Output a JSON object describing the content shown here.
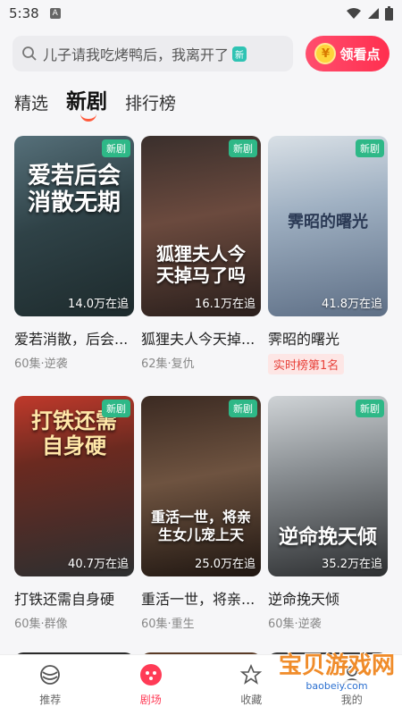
{
  "status": {
    "time": "5:38",
    "sim_icon": "A"
  },
  "search": {
    "query": "儿子请我吃烤鸭后，我离开了",
    "badge": "新"
  },
  "coin_button": {
    "label": "领看点",
    "coin_symbol": "¥"
  },
  "tabs": [
    {
      "label": "精选",
      "active": false
    },
    {
      "label": "新剧",
      "active": true
    },
    {
      "label": "排行榜",
      "active": false
    }
  ],
  "items": [
    {
      "title": "爱若消散，后会...",
      "followers": "14.0万在追",
      "meta": "60集·逆袭",
      "tag": "新剧",
      "poster_text": "爱若后会消散无期"
    },
    {
      "title": "狐狸夫人今天掉...",
      "followers": "16.1万在追",
      "meta": "62集·复仇",
      "tag": "新剧",
      "poster_text": "狐狸夫人今天掉马了吗"
    },
    {
      "title": "霁昭的曙光",
      "followers": "41.8万在追",
      "meta": "",
      "rank": "实时榜第1名",
      "tag": "新剧",
      "poster_text": "霁昭的曙光"
    },
    {
      "title": "打铁还需自身硬",
      "followers": "40.7万在追",
      "meta": "60集·群像",
      "tag": "新剧",
      "poster_text": "打铁还需自身硬"
    },
    {
      "title": "重活一世，将亲...",
      "followers": "25.0万在追",
      "meta": "60集·重生",
      "tag": "新剧",
      "poster_text": "重活一世，将亲生女儿宠上天"
    },
    {
      "title": "逆命挽天倾",
      "followers": "35.2万在追",
      "meta": "60集·逆袭",
      "tag": "新剧",
      "poster_text": "逆命挽天倾"
    }
  ],
  "nav": [
    {
      "label": "推荐",
      "icon": "recommend-icon",
      "active": false
    },
    {
      "label": "剧场",
      "icon": "theater-icon",
      "active": true
    },
    {
      "label": "收藏",
      "icon": "favorites-icon",
      "active": false
    },
    {
      "label": "我的",
      "icon": "profile-icon",
      "active": false
    }
  ],
  "watermark": {
    "title": "宝贝游戏网",
    "url": "baobeiy.com"
  },
  "colors": {
    "accent": "#ff3b56",
    "new_tag": "#2eb887",
    "rank_text": "#e8413a"
  }
}
